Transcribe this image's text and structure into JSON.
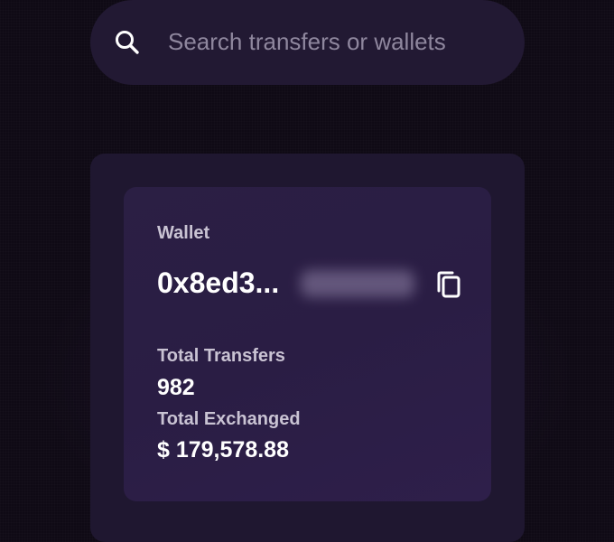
{
  "search": {
    "placeholder": "Search transfers or wallets",
    "icon": "search-icon"
  },
  "wallet": {
    "label": "Wallet",
    "address_visible": "0x8ed3...",
    "address_redacted": true,
    "copy_icon": "copy-icon"
  },
  "stats": {
    "total_transfers_label": "Total Transfers",
    "total_transfers_value": "982",
    "total_exchanged_label": "Total Exchanged",
    "total_exchanged_value": "$ 179,578.88"
  },
  "colors": {
    "background": "#0f0a15",
    "search_bar": "#221933",
    "outer_panel": "#1f1730",
    "card": "#2b1f44",
    "label_text": "#c9c3d3",
    "value_text": "#ffffff",
    "placeholder_text": "#8f879e"
  }
}
